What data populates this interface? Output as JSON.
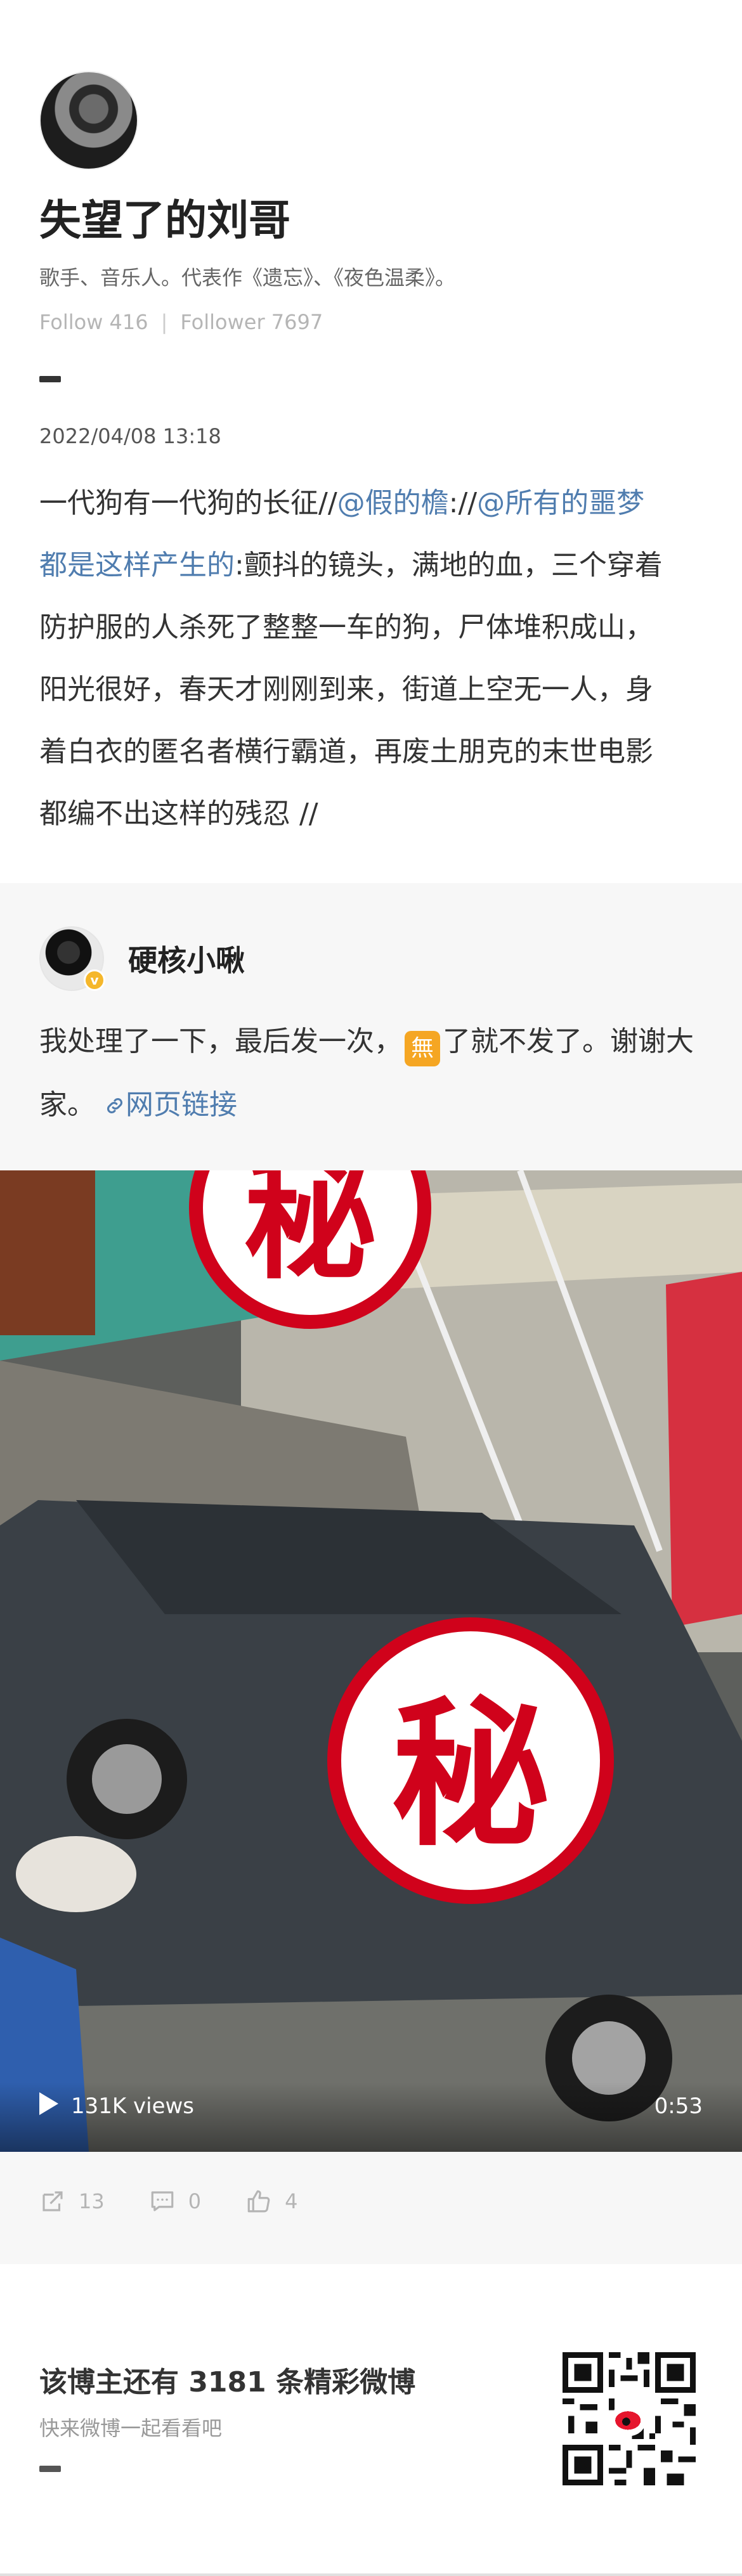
{
  "profile": {
    "username": "失望了的刘哥",
    "bio": "歌手、音乐人。代表作《遗忘》、《夜色温柔》。",
    "follow_label": "Follow",
    "follow_count": "416",
    "follower_label": "Follower",
    "follower_count": "7697"
  },
  "post": {
    "date": "2022/04/08 13:18",
    "text_before": "一代狗有一代狗的长征//",
    "mention1": "@假的檐",
    "text_mid": "://",
    "mention2": "@所有的噩梦都是这样产生的",
    "text_after": ":颤抖的镜头，满地的血，三个穿着防护服的人杀死了整整一车的狗，尸体堆积成山，阳光很好，春天才刚刚到来，街道上空无一人，身着白衣的匿名者横行霸道，再废土朋克的末世电影都编不出这样的残忍 //"
  },
  "repost": {
    "author": "硬核小啾",
    "verified_badge": "v",
    "text_before": "我处理了一下，最后发一次，",
    "emoji": "無",
    "text_after": "了就不发了。谢谢大家。",
    "link_label": "网页链接",
    "video": {
      "views": "131K views",
      "duration": "0:53",
      "stamp_text": "秘"
    },
    "actions": {
      "reposts": "13",
      "comments": "0",
      "likes": "4"
    }
  },
  "promo": {
    "title": "该博主还有 3181 条精彩微博",
    "subtitle": "快来微博一起看看吧"
  },
  "colors": {
    "link": "#507daf",
    "stamp_red": "#d0021b",
    "muted": "#b5b5b5"
  }
}
